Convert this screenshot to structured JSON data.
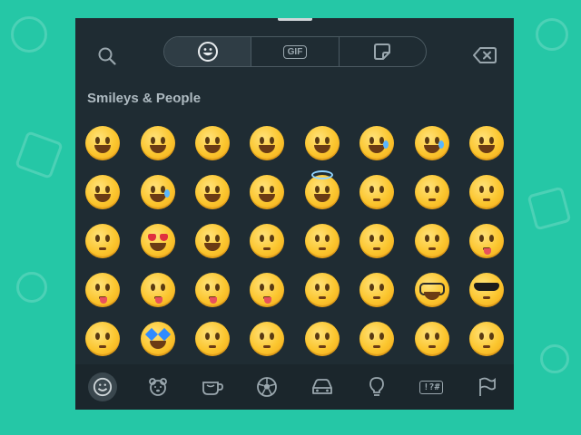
{
  "picker": {
    "tabs": [
      {
        "name": "emoji",
        "icon": "smiley-icon",
        "active": true
      },
      {
        "name": "gif",
        "label": "GIF",
        "icon": "gif-icon",
        "active": false
      },
      {
        "name": "sticker",
        "icon": "sticker-icon",
        "active": false
      }
    ],
    "search_icon": "search-icon",
    "backspace_icon": "backspace-icon",
    "section_title": "Smileys & People",
    "emoji_rows": [
      [
        "grinning",
        "grinning-big-eyes",
        "beaming",
        "grinning-squint",
        "laughing",
        "holding-back-tears",
        "sweat-smile",
        "tears-of-joy"
      ],
      [
        "rolling-laughing",
        "smiling-tear",
        "smiling-blush",
        "blush",
        "halo",
        "slight-smile",
        "upside-down",
        "wink"
      ],
      [
        "relieved",
        "heart-eyes",
        "smiling-hearts",
        "kissing-heart",
        "kissing",
        "kissing-smiling-eyes",
        "kissing-closed-eyes",
        "yum"
      ],
      [
        "tongue-out",
        "squinting-tongue",
        "winking-tongue",
        "zany",
        "raised-eyebrow",
        "monocle",
        "nerd",
        "sunglasses"
      ],
      [
        "disguised",
        "star-struck",
        "partying",
        "smirk",
        "unamused",
        "disappointed",
        "pensive",
        "worried"
      ]
    ],
    "categories": [
      {
        "name": "smileys",
        "icon": "smiley-icon",
        "active": true
      },
      {
        "name": "animals",
        "icon": "bear-icon",
        "active": false
      },
      {
        "name": "food",
        "icon": "cup-icon",
        "active": false
      },
      {
        "name": "activities",
        "icon": "soccer-ball-icon",
        "active": false
      },
      {
        "name": "travel",
        "icon": "car-icon",
        "active": false
      },
      {
        "name": "objects",
        "icon": "lightbulb-icon",
        "active": false
      },
      {
        "name": "symbols",
        "label": "!?#",
        "icon": "symbols-icon",
        "active": false
      },
      {
        "name": "flags",
        "icon": "flag-icon",
        "active": false
      }
    ],
    "colors": {
      "background": "#25c7a6",
      "panel": "#1f2c33",
      "icon": "#9aa7ae",
      "accent_active": "#3a474e"
    }
  }
}
